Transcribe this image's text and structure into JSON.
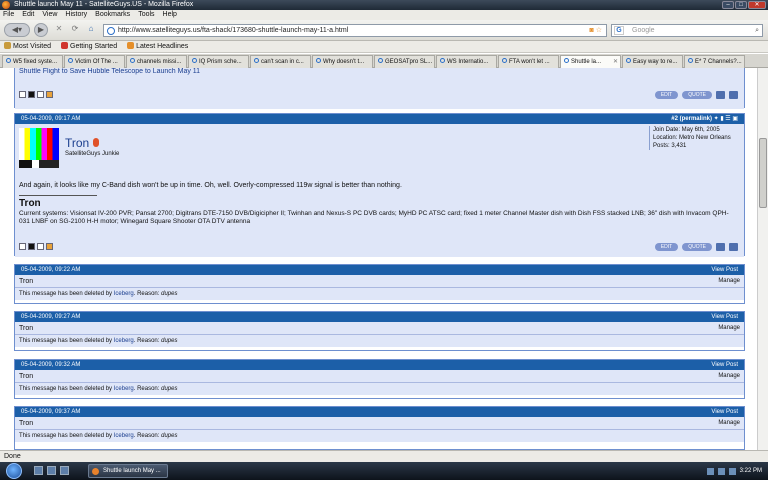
{
  "window": {
    "title": "Shuttle launch May 11 - SatelliteGuys.US - Mozilla Firefox"
  },
  "menu": [
    "File",
    "Edit",
    "View",
    "History",
    "Bookmarks",
    "Tools",
    "Help"
  ],
  "nav": {
    "url": "http://www.satelliteguys.us/fta-shack/173680-shuttle-launch-may-11-a.html",
    "search_placeholder": "Google",
    "search_engine": "G"
  },
  "bookmarks": [
    {
      "label": "Most Visited",
      "color": "#c89a3a"
    },
    {
      "label": "Getting Started",
      "color": "#d0342c"
    },
    {
      "label": "Latest Headlines",
      "color": "#e58f2a"
    }
  ],
  "tabs": [
    "W5 fixed syste...",
    "Victim Of The ...",
    "channels missi...",
    "IQ Prism sche...",
    "can't scan in c...",
    "Why doesn't t...",
    "GEOSATpro SL...",
    "WS Internatio...",
    "FTA won't let ...",
    "Shuttle la...",
    "Easy way to re...",
    "E* 7 Channels?..."
  ],
  "active_tab": 9,
  "top_snippet": "Shuttle Flight to Save Hubble Telescope to Launch May 11",
  "buttons": {
    "edit": "EDIT",
    "quote": "QUOTE"
  },
  "post": {
    "date": "05-04-2009, 09:17 AM",
    "num": "#2 (permalink)",
    "username": "Tron",
    "title": "SatelliteGuys Junkie",
    "join": "Join Date: May 6th, 2005",
    "location": "Location: Metro New Orleans",
    "posts": "Posts: 3,431",
    "message": "And again, it looks like my C-Band dish won't be up in time. Oh, well. Overly-compressed 119w signal is better than nothing.",
    "sig_name": "Tron",
    "sig_text": "Current systems: Visionsat IV-200 PVR; Pansat 2700; Digitrans DTE-7150 DVB/Digicipher II; Twinhan and Nexus-S PC DVB cards; MyHD PC ATSC card; fixed 1 meter Channel Master dish with Dish FSS stacked LNB; 36\" dish with Invacom QPH-031 LNBF on SG-2100 H-H motor; Winegard Square Shooter OTA DTV antenna"
  },
  "deleted": [
    {
      "date": "05-04-2009, 09:22 AM",
      "user": "Tron",
      "view": "View Post",
      "manage": "Manage",
      "pre": "This message has been deleted by",
      "by": "Iceberg",
      "reason_label": ". Reason:",
      "reason": "dupes"
    },
    {
      "date": "05-04-2009, 09:27 AM",
      "user": "Tron",
      "view": "View Post",
      "manage": "Manage",
      "pre": "This message has been deleted by",
      "by": "Iceberg",
      "reason_label": ". Reason:",
      "reason": "dupes"
    },
    {
      "date": "05-04-2009, 09:32 AM",
      "user": "Tron",
      "view": "View Post",
      "manage": "Manage",
      "pre": "This message has been deleted by",
      "by": "Iceberg",
      "reason_label": ". Reason:",
      "reason": "dupes"
    },
    {
      "date": "05-04-2009, 09:37 AM",
      "user": "Tron",
      "view": "View Post",
      "manage": "Manage",
      "pre": "This message has been deleted by",
      "by": "Iceberg",
      "reason_label": ". Reason:",
      "reason": "dupes"
    }
  ],
  "status": "Done",
  "taskbar": {
    "item": "Shuttle launch May ...",
    "time": "3:22 PM"
  }
}
